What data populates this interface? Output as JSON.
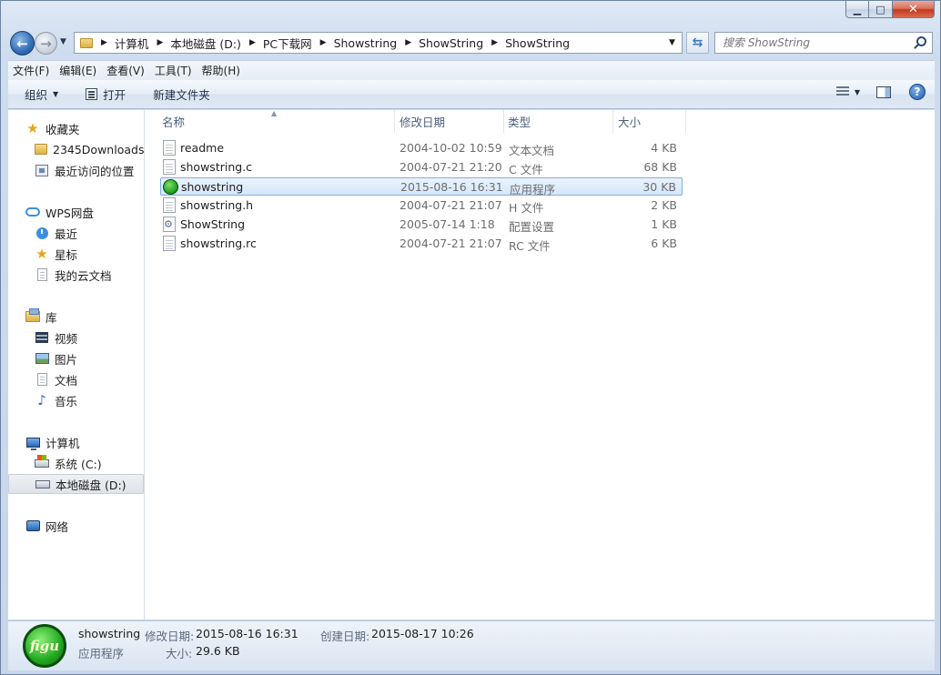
{
  "window": {
    "caption_min": "▁",
    "caption_max": "□",
    "caption_close": "✕"
  },
  "address_bar": {
    "crumbs": [
      "计算机",
      "本地磁盘 (D:)",
      "PC下载网",
      "Showstring",
      "ShowString",
      "ShowString"
    ]
  },
  "search": {
    "placeholder": "搜索 ShowString"
  },
  "menubar": {
    "items": [
      "文件(F)",
      "编辑(E)",
      "查看(V)",
      "工具(T)",
      "帮助(H)"
    ]
  },
  "toolbar": {
    "organize": "组织",
    "open": "打开",
    "new_folder": "新建文件夹",
    "help": "?"
  },
  "navpane": {
    "favorites": {
      "label": "收藏夹",
      "items": [
        "2345Downloads",
        "最近访问的位置"
      ]
    },
    "wps": {
      "label": "WPS网盘",
      "items": [
        "最近",
        "星标",
        "我的云文档"
      ]
    },
    "libraries": {
      "label": "库",
      "items": [
        "视频",
        "图片",
        "文档",
        "音乐"
      ]
    },
    "computer": {
      "label": "计算机",
      "items": [
        "系统 (C:)",
        "本地磁盘 (D:)"
      ]
    },
    "network": {
      "label": "网络"
    }
  },
  "columns": {
    "name": "名称",
    "date": "修改日期",
    "type": "类型",
    "size": "大小"
  },
  "files": [
    {
      "name": "readme",
      "date": "2004-10-02 10:59",
      "type": "文本文档",
      "size": "4 KB",
      "icon": "text-file-icon"
    },
    {
      "name": "showstring.c",
      "date": "2004-07-21 21:20",
      "type": "C 文件",
      "size": "68 KB",
      "icon": "text-file-icon"
    },
    {
      "name": "showstring",
      "date": "2015-08-16 16:31",
      "type": "应用程序",
      "size": "30 KB",
      "icon": "exe-icon",
      "selected": true
    },
    {
      "name": "showstring.h",
      "date": "2004-07-21 21:07",
      "type": "H 文件",
      "size": "2 KB",
      "icon": "text-file-icon"
    },
    {
      "name": "ShowString",
      "date": "2005-07-14 1:18",
      "type": "配置设置",
      "size": "1 KB",
      "icon": "config-file-icon"
    },
    {
      "name": "showstring.rc",
      "date": "2004-07-21 21:07",
      "type": "RC 文件",
      "size": "6 KB",
      "icon": "text-file-icon"
    }
  ],
  "details": {
    "icon_text": "figu",
    "name": "showstring",
    "type": "应用程序",
    "modified_label": "修改日期:",
    "modified_value": "2015-08-16 16:31",
    "created_label": "创建日期:",
    "created_value": "2015-08-17 10:26",
    "size_label": "大小:",
    "size_value": "29.6 KB"
  }
}
